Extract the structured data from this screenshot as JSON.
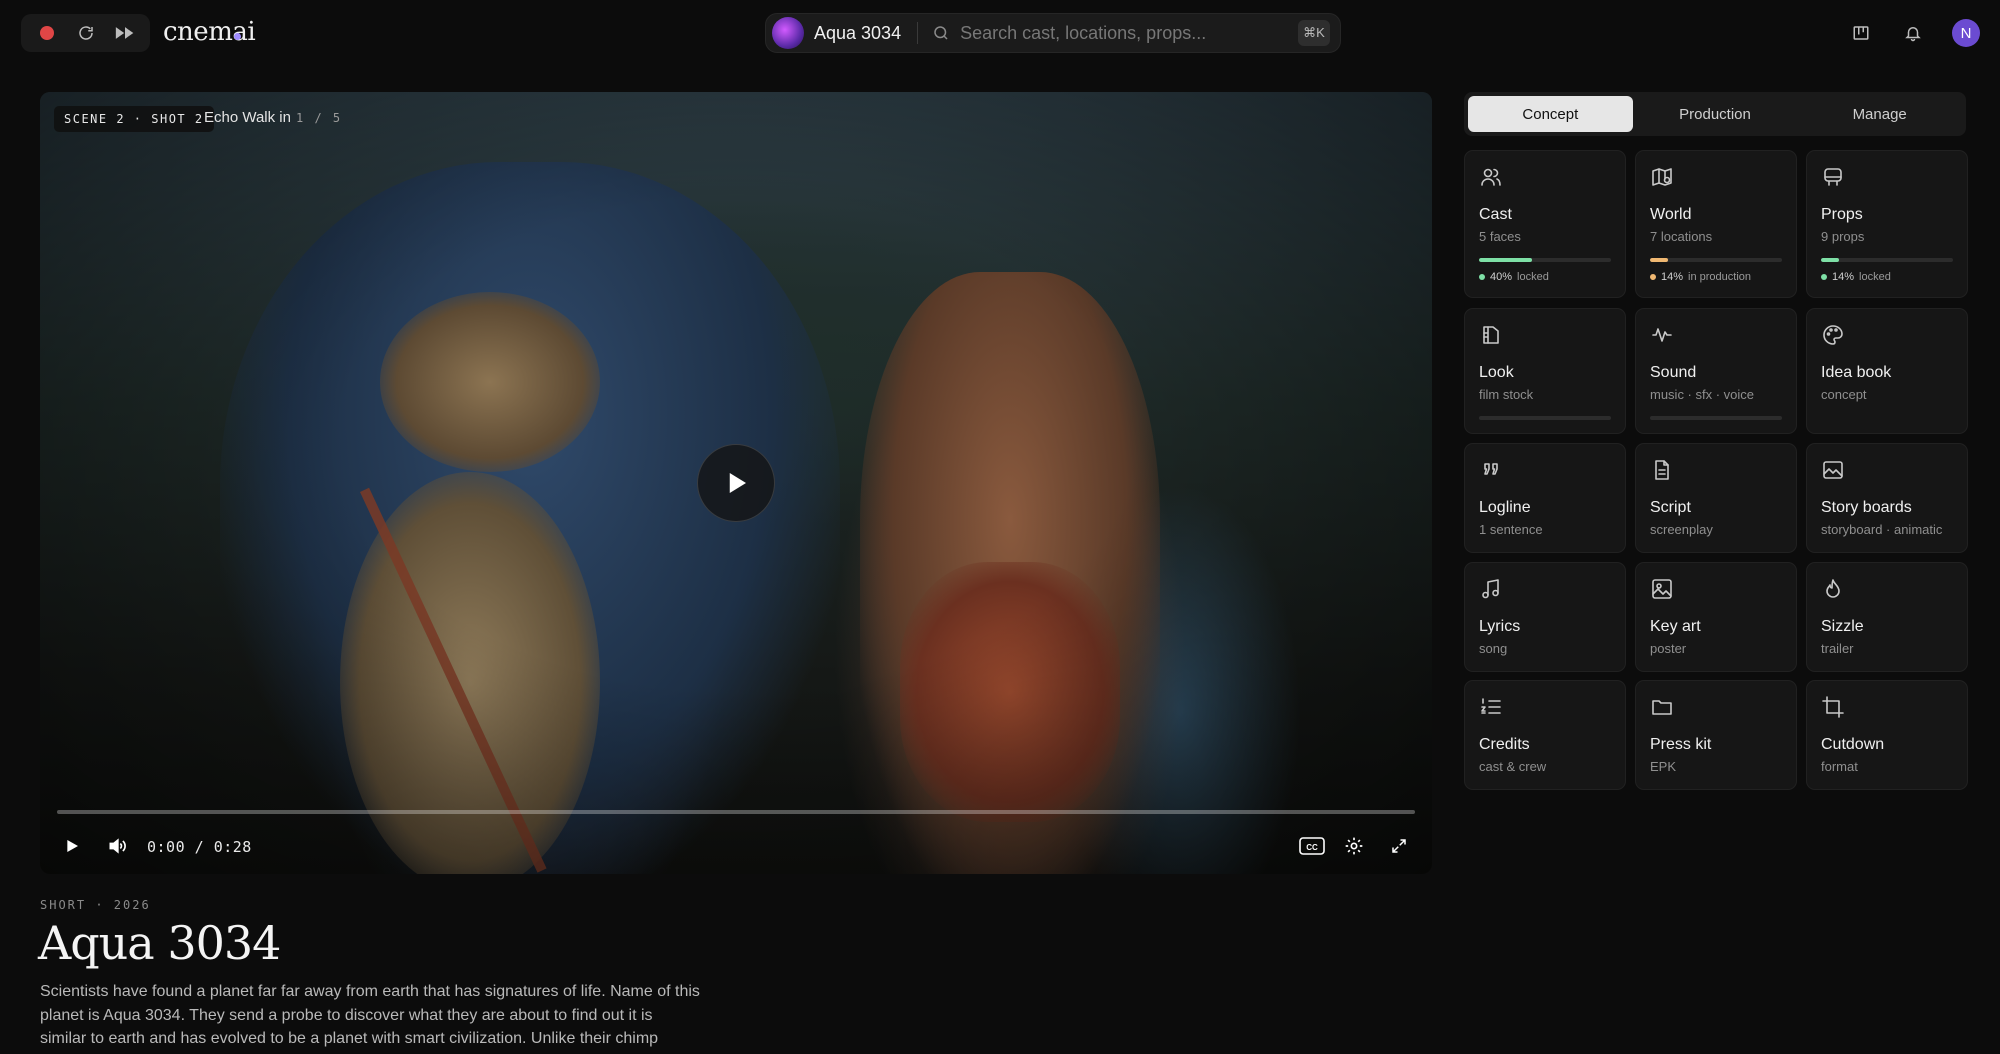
{
  "app": {
    "brand": "cnemai"
  },
  "topbar": {
    "project_name": "Aqua 3034",
    "search_placeholder": "Search cast, locations, props...",
    "shortcut": "⌘K",
    "avatar_initial": "N"
  },
  "video": {
    "scene_label": "SCENE 2 · SHOT 2",
    "shot_title": "Echo Walk in",
    "shot_count": "1 / 5",
    "time": "0:00 / 0:28",
    "progress": 0
  },
  "film": {
    "meta": "SHORT · 2026",
    "title": "Aqua 3034",
    "synopsis": "Scientists have found a planet far far away from earth that has signatures of life. Name of this planet is Aqua 3034. They send a probe to discover what they are about to find out it is similar to earth and has evolved to be a planet with smart civilization. Unlike their chimp"
  },
  "tabs": [
    "Concept",
    "Production",
    "Manage"
  ],
  "active_tab": "Concept",
  "cards": [
    {
      "icon": "cast-icon",
      "title": "Cast",
      "sub": "5 faces",
      "progress": 0.4,
      "bar_color": "#7ee0a6",
      "status_value": "40%",
      "status_text": "locked",
      "status_color": "#7ee0a6"
    },
    {
      "icon": "world-map-icon",
      "title": "World",
      "sub": "7 locations",
      "progress": 0.14,
      "bar_color": "#f0b872",
      "status_value": "14%",
      "status_text": "in production",
      "status_color": "#f0b872"
    },
    {
      "icon": "props-icon",
      "title": "Props",
      "sub": "9 props",
      "progress": 0.14,
      "bar_color": "#7ee0a6",
      "status_value": "14%",
      "status_text": "locked",
      "status_color": "#7ee0a6"
    },
    {
      "icon": "film-stock-icon",
      "title": "Look",
      "sub": "film stock",
      "progress": 0,
      "bar_color": "#7ee0a6"
    },
    {
      "icon": "sound-wave-icon",
      "title": "Sound",
      "sub": "music · sfx · voice",
      "progress": 0,
      "bar_color": "#7ee0a6"
    },
    {
      "icon": "palette-icon",
      "title": "Idea book",
      "sub": "concept"
    },
    {
      "icon": "quote-icon",
      "title": "Logline",
      "sub": "1 sentence"
    },
    {
      "icon": "document-icon",
      "title": "Script",
      "sub": "screenplay"
    },
    {
      "icon": "image-frame-icon",
      "title": "Story boards",
      "sub": "storyboard · animatic"
    },
    {
      "icon": "music-note-icon",
      "title": "Lyrics",
      "sub": "song"
    },
    {
      "icon": "image-icon",
      "title": "Key art",
      "sub": "poster"
    },
    {
      "icon": "flame-icon",
      "title": "Sizzle",
      "sub": "trailer"
    },
    {
      "icon": "numbered-list-icon",
      "title": "Credits",
      "sub": "cast & crew"
    },
    {
      "icon": "folder-icon",
      "title": "Press kit",
      "sub": "EPK"
    },
    {
      "icon": "crop-icon",
      "title": "Cutdown",
      "sub": "format"
    }
  ]
}
